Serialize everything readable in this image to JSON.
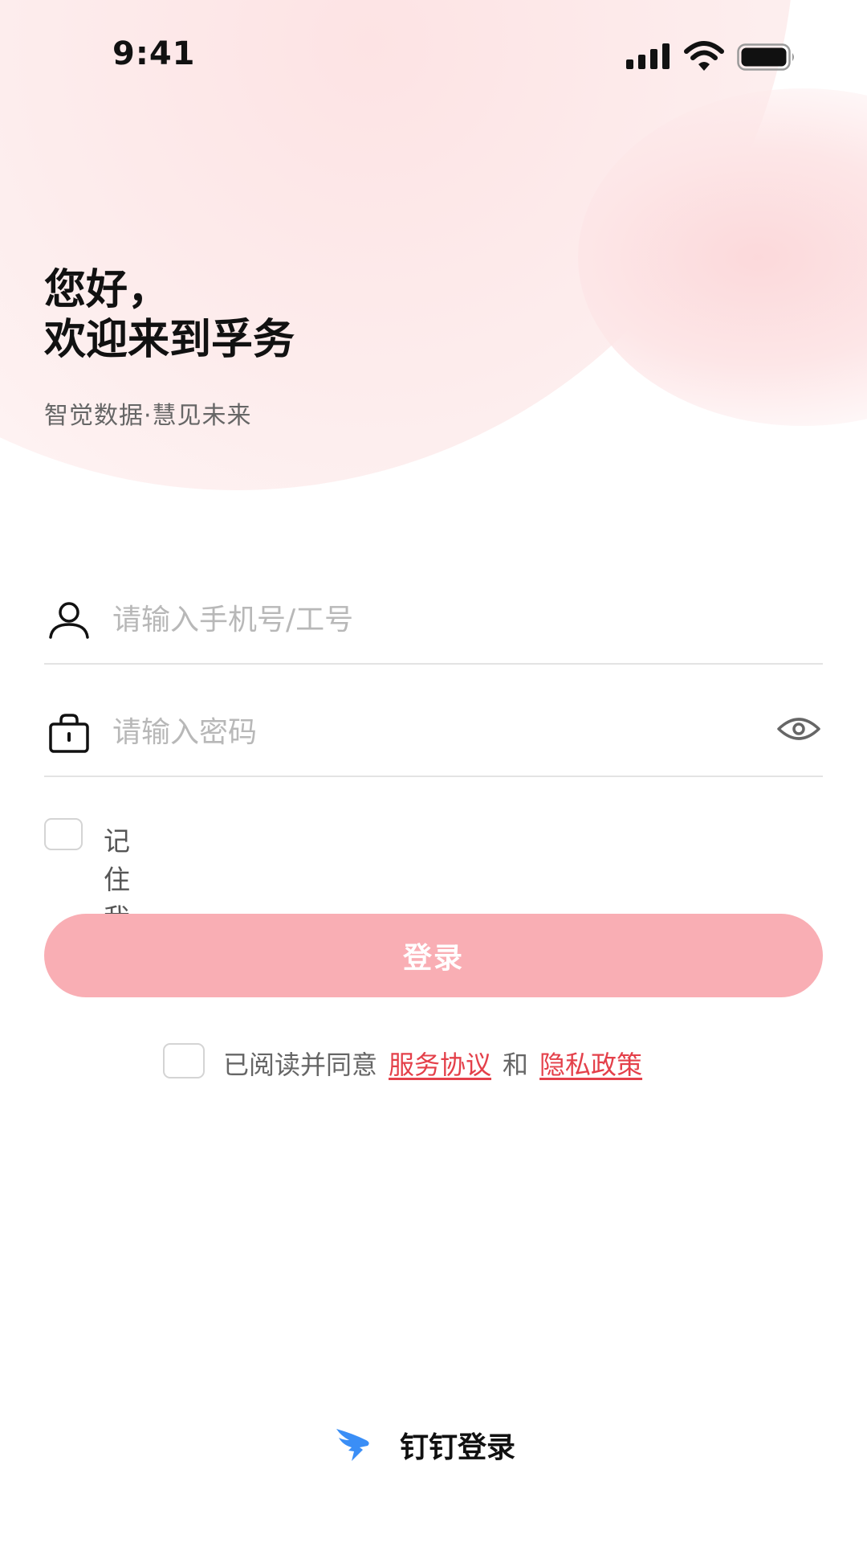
{
  "status_bar": {
    "time": "9:41",
    "icons": [
      "cellular-signal-icon",
      "wifi-icon",
      "battery-icon"
    ]
  },
  "greeting": {
    "line1": "您好，",
    "line2": "欢迎来到孚务"
  },
  "slogan": "智觉数据·慧见未来",
  "login_form": {
    "phone": {
      "icon": "user-icon",
      "value": "",
      "placeholder": "请输入手机号/工号"
    },
    "password": {
      "icon": "lock-icon",
      "value": "",
      "placeholder": "请输入密码",
      "toggle_icon": "eye-icon"
    },
    "remember_me": {
      "label": "记住我",
      "checked": false
    },
    "submit_label": "登录"
  },
  "agreement": {
    "checked": false,
    "lead_text": "已阅读并同意",
    "service_link": "服务协议",
    "connector": "和",
    "privacy_link": "隐私政策"
  },
  "third_party_login": {
    "icon": "dingtalk-icon",
    "label": "钉钉登录"
  },
  "colors": {
    "accent": "#e4404a",
    "button_bg": "#f9aeb4",
    "button_text": "#ffffff",
    "placeholder": "#b8b8b8",
    "dingtalk_blue": "#3a8ef6"
  }
}
